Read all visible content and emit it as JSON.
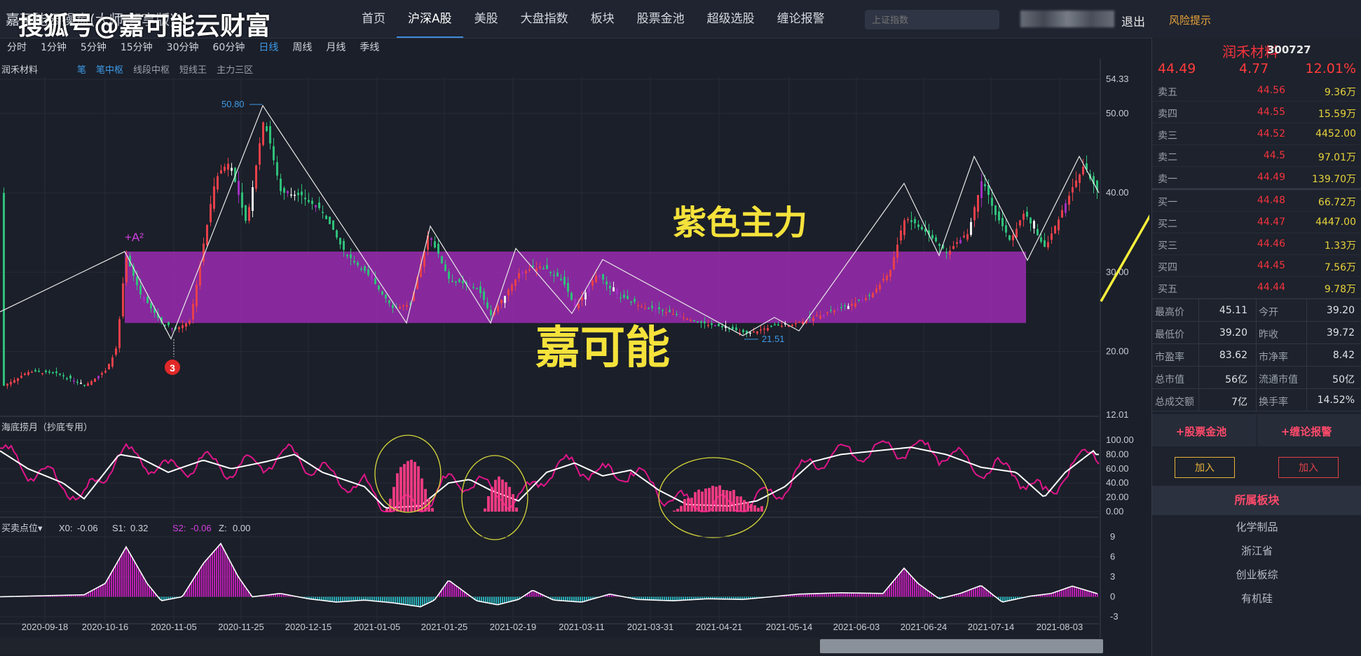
{
  "header": {
    "app_title": "嘉可能云操盘(大师·智享版)",
    "watermark": "搜狐号@嘉可能云财富",
    "nav": [
      "首页",
      "沪深A股",
      "美股",
      "大盘指数",
      "板块",
      "股票金池",
      "超级选股",
      "缠论报警"
    ],
    "nav_active": 1,
    "search_placeholder": "上证指数",
    "logout": "退出",
    "risk": "风险提示"
  },
  "periods": [
    "分时",
    "1分钟",
    "5分钟",
    "15分钟",
    "30分钟",
    "60分钟",
    "日线",
    "周线",
    "月线",
    "季线"
  ],
  "period_active": 6,
  "main_chart": {
    "stock": "润禾材料",
    "indicators": [
      "笔",
      "笔中枢",
      "线段中枢",
      "短线王",
      "主力三区"
    ],
    "indicators_active": [
      0,
      1
    ],
    "y_ticks": [
      "54.33",
      "50.00",
      "40.00",
      "30.00",
      "20.00",
      "12.01"
    ],
    "label_high": "50.80",
    "label_low": "21.51",
    "label_a2": "+A²",
    "label_3": "3",
    "annotation_zone": "紫色主力",
    "annotation_brand": "嘉可能",
    "colors": {
      "zone": "#9a2bb0",
      "up": "#e8404a",
      "down": "#2fc07a"
    }
  },
  "sub1": {
    "title": "海底捞月（抄底专用）",
    "y_ticks": [
      "100.00",
      "80.00",
      "60.00",
      "40.00",
      "20.00",
      "0.00"
    ]
  },
  "sub2": {
    "title": "买卖点位▾",
    "readouts": [
      {
        "k": "X0:",
        "v": "-0.06"
      },
      {
        "k": "S1:",
        "v": "0.32"
      },
      {
        "k": "S2:",
        "v": "-0.06"
      },
      {
        "k": "Z:",
        "v": "0.00"
      }
    ],
    "y_ticks": [
      "9",
      "6",
      "3",
      "0",
      "-3"
    ]
  },
  "x_dates": [
    "2020-09-18",
    "2020-10-16",
    "2020-11-05",
    "2020-11-25",
    "2020-12-15",
    "2021-01-05",
    "2021-01-25",
    "2021-02-19",
    "2021-03-11",
    "2021-03-31",
    "2021-04-21",
    "2021-05-14",
    "2021-06-03",
    "2021-06-24",
    "2021-07-14",
    "2021-08-03"
  ],
  "panel": {
    "name": "润禾材料",
    "code": "300727",
    "price": "44.49",
    "change": "4.77",
    "pct": "12.01%",
    "asks": [
      {
        "label": "卖五",
        "price": "44.56",
        "vol": "9.36万"
      },
      {
        "label": "卖四",
        "price": "44.55",
        "vol": "15.59万"
      },
      {
        "label": "卖三",
        "price": "44.52",
        "vol": "4452.00"
      },
      {
        "label": "卖二",
        "price": "44.5",
        "vol": "97.01万"
      },
      {
        "label": "卖一",
        "price": "44.49",
        "vol": "139.70万"
      }
    ],
    "bids": [
      {
        "label": "买一",
        "price": "44.48",
        "vol": "66.72万"
      },
      {
        "label": "买二",
        "price": "44.47",
        "vol": "4447.00"
      },
      {
        "label": "买三",
        "price": "44.46",
        "vol": "1.33万"
      },
      {
        "label": "买四",
        "price": "44.45",
        "vol": "7.56万"
      },
      {
        "label": "买五",
        "price": "44.44",
        "vol": "9.78万"
      }
    ],
    "stats": [
      [
        "最高价",
        "45.11",
        "今开",
        "39.20"
      ],
      [
        "最低价",
        "39.20",
        "昨收",
        "39.72"
      ],
      [
        "市盈率",
        "83.62",
        "市净率",
        "8.42"
      ],
      [
        "总市值",
        "56亿",
        "流通市值",
        "50亿"
      ],
      [
        "总成交额",
        "7亿",
        "换手率",
        "14.52%"
      ]
    ],
    "action_left": "+股票金池",
    "action_right": "+缠论报警",
    "add_label": "加入",
    "sector_title": "所属板块",
    "sectors": [
      "化学制品",
      "浙江省",
      "创业板综",
      "有机硅"
    ]
  }
}
